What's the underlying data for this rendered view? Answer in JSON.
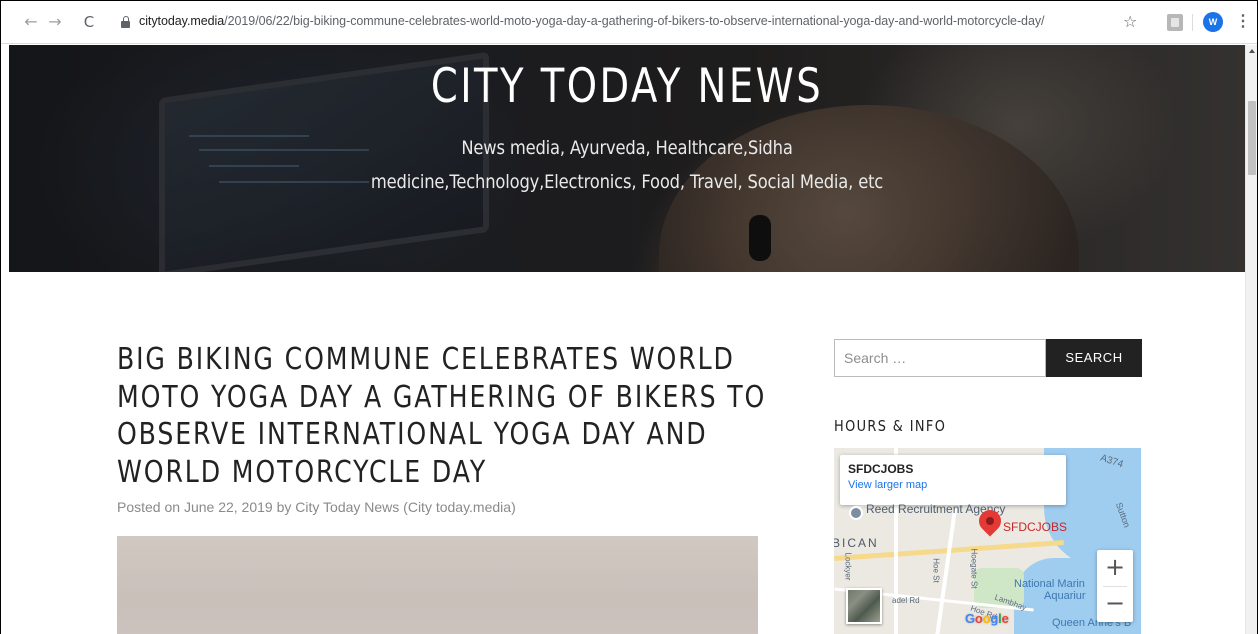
{
  "browser": {
    "url_host": "citytoday.media",
    "url_path": "/2019/06/22/big-biking-commune-celebrates-world-moto-yoga-day-a-gathering-of-bikers-to-observe-international-yoga-day-and-world-motorcycle-day/",
    "profile_initial": "W",
    "icons": [
      "back-arrow-icon",
      "forward-arrow-icon",
      "reload-icon",
      "lock-icon",
      "star-icon",
      "pdf-extension-icon",
      "profile-avatar-icon",
      "menu-dots-icon"
    ]
  },
  "site": {
    "title": "CITY TODAY NEWS",
    "description": "News media, Ayurveda, Healthcare,Sidha medicine,Technology,Electronics, Food, Travel, Social Media, etc"
  },
  "article": {
    "title": "BIG BIKING COMMUNE CELEBRATES WORLD MOTO YOGA DAY A GATHERING OF BIKERS TO OBSERVE INTERNATIONAL YOGA DAY AND WORLD MOTORCYCLE DAY",
    "posted_prefix": "Posted on",
    "date": "June 22, 2019",
    "by_prefix": "by",
    "author": "City Today News (City today.media)"
  },
  "sidebar": {
    "search_placeholder": "Search …",
    "search_button": "SEARCH",
    "widget_title": "HOURS & INFO",
    "map": {
      "place_name": "SFDCJOBS",
      "view_larger": "View larger map",
      "poi_label": "Reed Recruitment Agency",
      "pin_label": "SFDCJOBS",
      "area_label": "BICAN",
      "labels": [
        "National Marin",
        "Aquariur",
        "Queen Anne's B",
        "A374",
        "Hoe St",
        "Lockyer",
        "Hoegate St",
        "adel Rd",
        "Lambhay",
        "Hoe Rd",
        "Sutton"
      ],
      "zoom_in": "+",
      "zoom_out": "−",
      "attribution": "Google"
    }
  }
}
